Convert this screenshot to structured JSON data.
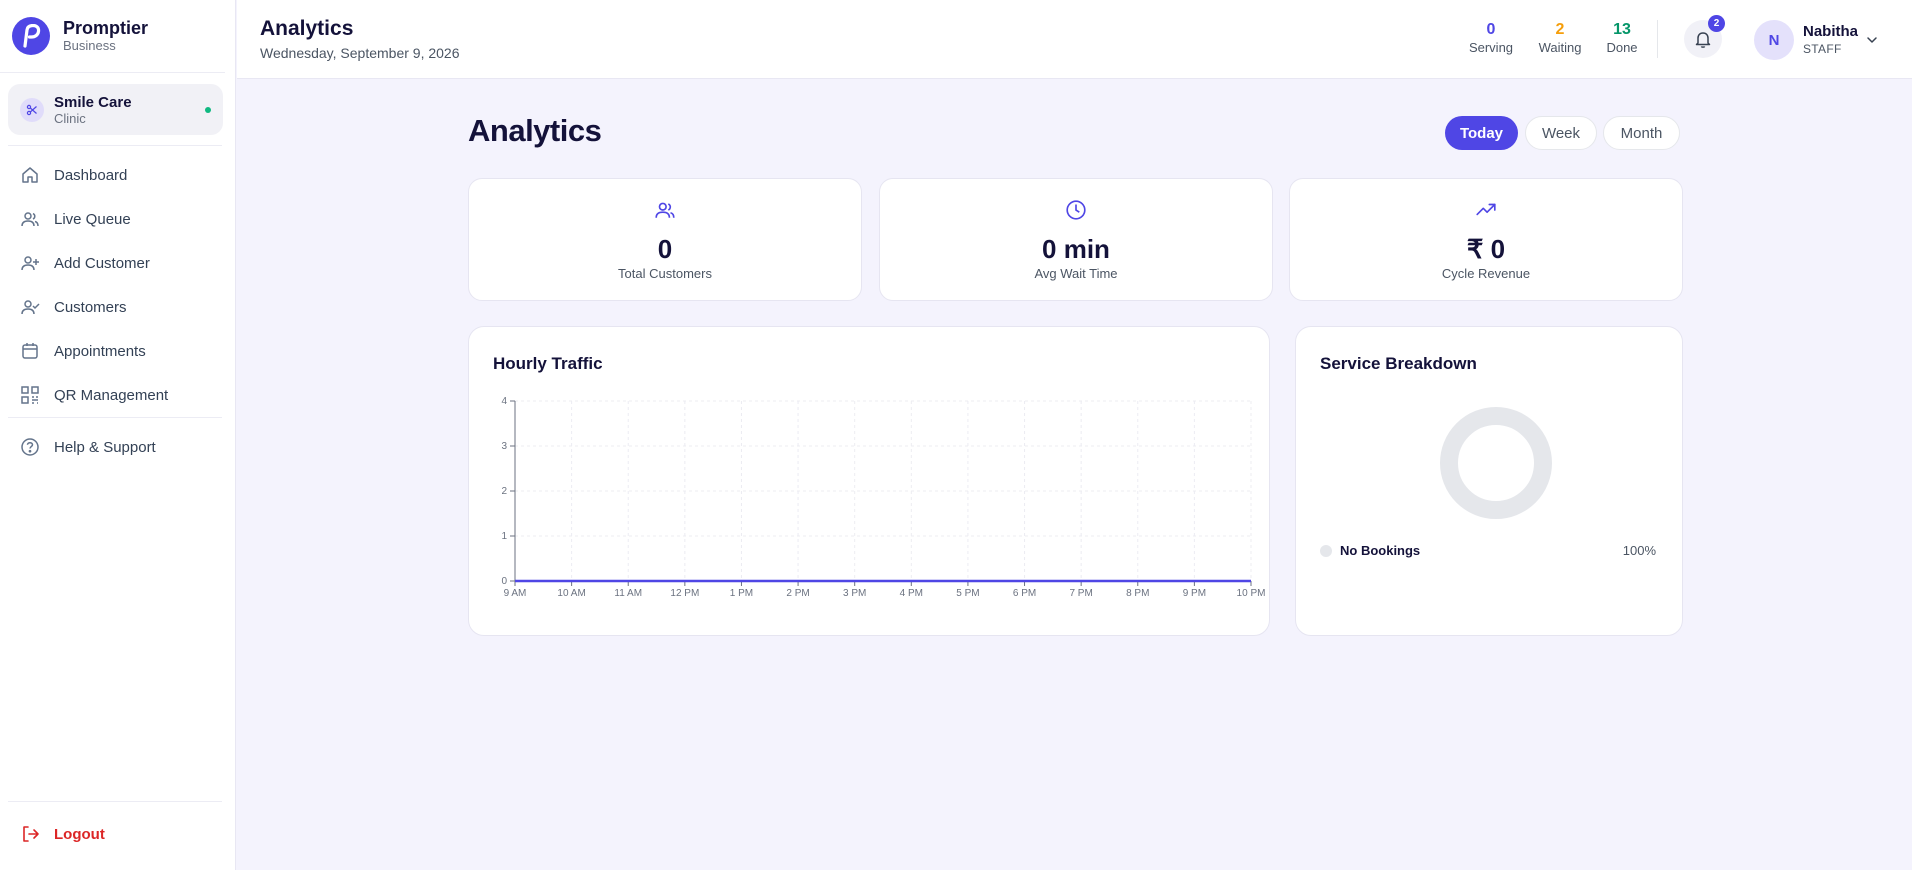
{
  "brand": {
    "name": "Promptier",
    "subtitle": "Business"
  },
  "clinic": {
    "name": "Smile Care",
    "type": "Clinic"
  },
  "nav": {
    "items": [
      {
        "label": "Dashboard",
        "icon": "home-icon"
      },
      {
        "label": "Live Queue",
        "icon": "users-icon"
      },
      {
        "label": "Add Customer",
        "icon": "user-plus-icon"
      },
      {
        "label": "Customers",
        "icon": "user-check-icon"
      },
      {
        "label": "Appointments",
        "icon": "calendar-icon"
      },
      {
        "label": "QR Management",
        "icon": "qr-icon"
      }
    ],
    "help": "Help & Support",
    "logout": "Logout"
  },
  "header": {
    "title": "Analytics",
    "date": "Wednesday, September 9, 2026",
    "stats": [
      {
        "value": "0",
        "label": "Serving",
        "color": "#4f46e5"
      },
      {
        "value": "2",
        "label": "Waiting",
        "color": "#f59e0b"
      },
      {
        "value": "13",
        "label": "Done",
        "color": "#059669"
      }
    ],
    "notifications": "2",
    "user": {
      "initial": "N",
      "name": "Nabitha",
      "role": "STAFF"
    }
  },
  "main": {
    "title": "Analytics",
    "ranges": [
      "Today",
      "Week",
      "Month"
    ],
    "active_range": "Today",
    "kpis": [
      {
        "value": "0",
        "label": "Total Customers",
        "icon": "users-icon"
      },
      {
        "value": "0 min",
        "label": "Avg Wait Time",
        "icon": "clock-icon"
      },
      {
        "value": "₹ 0",
        "label": "Cycle Revenue",
        "icon": "trending-up-icon"
      }
    ],
    "traffic_title": "Hourly Traffic",
    "breakdown": {
      "title": "Service Breakdown",
      "legend": [
        {
          "label": "No Bookings",
          "percent": "100%"
        }
      ]
    }
  },
  "colors": {
    "accent": "#4f46e5",
    "background": "#f4f3fd",
    "danger": "#dc2626",
    "online": "#10b981"
  },
  "chart_data": [
    {
      "type": "line",
      "title": "Hourly Traffic",
      "categories": [
        "9 AM",
        "10 AM",
        "11 AM",
        "12 PM",
        "1 PM",
        "2 PM",
        "3 PM",
        "4 PM",
        "5 PM",
        "6 PM",
        "7 PM",
        "8 PM",
        "9 PM",
        "10 PM"
      ],
      "series": [
        {
          "values": [
            0,
            0,
            0,
            0,
            0,
            0,
            0,
            0,
            0,
            0,
            0,
            0,
            0,
            0
          ]
        }
      ],
      "ylim": [
        0,
        4
      ],
      "yticks": [
        "0",
        "1",
        "2",
        "3",
        "4"
      ],
      "grid": true,
      "line_color": "#4f46e5"
    },
    {
      "type": "pie",
      "title": "Service Breakdown",
      "categories": [
        "No Bookings"
      ],
      "values": [
        100
      ],
      "donut": true,
      "slice_color": "#e5e7eb"
    }
  ]
}
